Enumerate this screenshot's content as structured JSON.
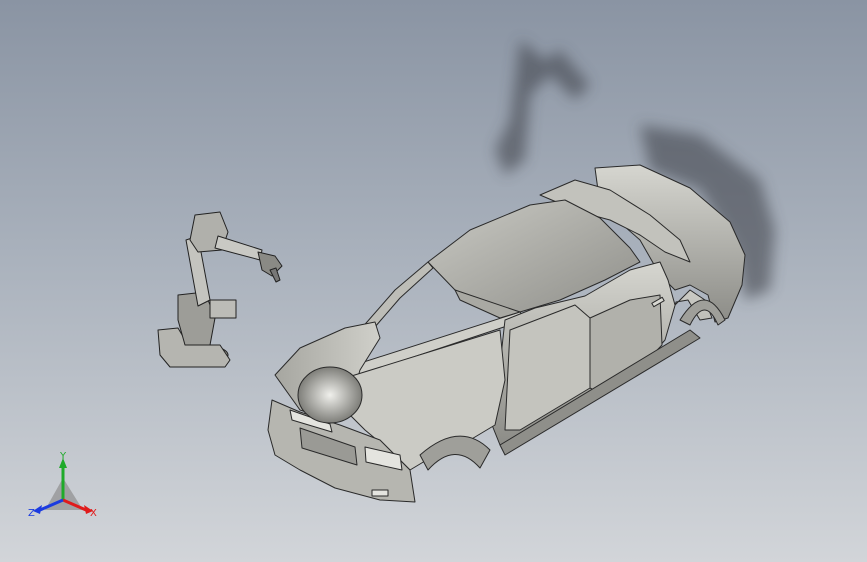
{
  "viewport": {
    "name": "cad-3d-viewport",
    "background_top": "#8a94a3",
    "background_bottom": "#d2d5d9"
  },
  "model": {
    "car_body_color": "#b8b8b2",
    "robot_color": "#a7a7a2",
    "shadow_color": "#3a3d44"
  },
  "triad": {
    "x_label": "X",
    "y_label": "Y",
    "z_label": "Z",
    "x_color": "#e01b1b",
    "y_color": "#1faa2a",
    "z_color": "#1b3be0"
  }
}
